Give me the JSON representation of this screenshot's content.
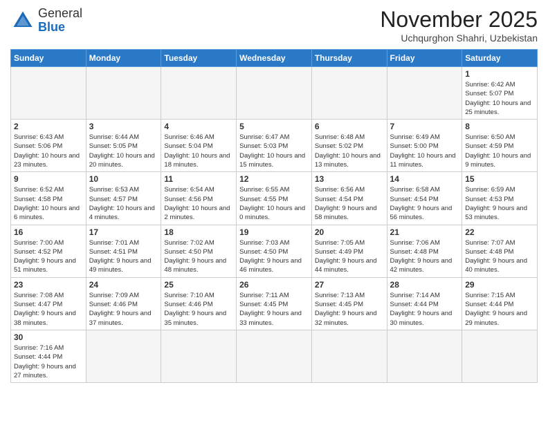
{
  "header": {
    "logo_general": "General",
    "logo_blue": "Blue",
    "month_title": "November 2025",
    "subtitle": "Uchqurghon Shahri, Uzbekistan"
  },
  "weekdays": [
    "Sunday",
    "Monday",
    "Tuesday",
    "Wednesday",
    "Thursday",
    "Friday",
    "Saturday"
  ],
  "weeks": [
    [
      {
        "day": "",
        "info": ""
      },
      {
        "day": "",
        "info": ""
      },
      {
        "day": "",
        "info": ""
      },
      {
        "day": "",
        "info": ""
      },
      {
        "day": "",
        "info": ""
      },
      {
        "day": "",
        "info": ""
      },
      {
        "day": "1",
        "info": "Sunrise: 6:42 AM\nSunset: 5:07 PM\nDaylight: 10 hours and 25 minutes."
      }
    ],
    [
      {
        "day": "2",
        "info": "Sunrise: 6:43 AM\nSunset: 5:06 PM\nDaylight: 10 hours and 23 minutes."
      },
      {
        "day": "3",
        "info": "Sunrise: 6:44 AM\nSunset: 5:05 PM\nDaylight: 10 hours and 20 minutes."
      },
      {
        "day": "4",
        "info": "Sunrise: 6:46 AM\nSunset: 5:04 PM\nDaylight: 10 hours and 18 minutes."
      },
      {
        "day": "5",
        "info": "Sunrise: 6:47 AM\nSunset: 5:03 PM\nDaylight: 10 hours and 15 minutes."
      },
      {
        "day": "6",
        "info": "Sunrise: 6:48 AM\nSunset: 5:02 PM\nDaylight: 10 hours and 13 minutes."
      },
      {
        "day": "7",
        "info": "Sunrise: 6:49 AM\nSunset: 5:00 PM\nDaylight: 10 hours and 11 minutes."
      },
      {
        "day": "8",
        "info": "Sunrise: 6:50 AM\nSunset: 4:59 PM\nDaylight: 10 hours and 9 minutes."
      }
    ],
    [
      {
        "day": "9",
        "info": "Sunrise: 6:52 AM\nSunset: 4:58 PM\nDaylight: 10 hours and 6 minutes."
      },
      {
        "day": "10",
        "info": "Sunrise: 6:53 AM\nSunset: 4:57 PM\nDaylight: 10 hours and 4 minutes."
      },
      {
        "day": "11",
        "info": "Sunrise: 6:54 AM\nSunset: 4:56 PM\nDaylight: 10 hours and 2 minutes."
      },
      {
        "day": "12",
        "info": "Sunrise: 6:55 AM\nSunset: 4:55 PM\nDaylight: 10 hours and 0 minutes."
      },
      {
        "day": "13",
        "info": "Sunrise: 6:56 AM\nSunset: 4:54 PM\nDaylight: 9 hours and 58 minutes."
      },
      {
        "day": "14",
        "info": "Sunrise: 6:58 AM\nSunset: 4:54 PM\nDaylight: 9 hours and 56 minutes."
      },
      {
        "day": "15",
        "info": "Sunrise: 6:59 AM\nSunset: 4:53 PM\nDaylight: 9 hours and 53 minutes."
      }
    ],
    [
      {
        "day": "16",
        "info": "Sunrise: 7:00 AM\nSunset: 4:52 PM\nDaylight: 9 hours and 51 minutes."
      },
      {
        "day": "17",
        "info": "Sunrise: 7:01 AM\nSunset: 4:51 PM\nDaylight: 9 hours and 49 minutes."
      },
      {
        "day": "18",
        "info": "Sunrise: 7:02 AM\nSunset: 4:50 PM\nDaylight: 9 hours and 48 minutes."
      },
      {
        "day": "19",
        "info": "Sunrise: 7:03 AM\nSunset: 4:50 PM\nDaylight: 9 hours and 46 minutes."
      },
      {
        "day": "20",
        "info": "Sunrise: 7:05 AM\nSunset: 4:49 PM\nDaylight: 9 hours and 44 minutes."
      },
      {
        "day": "21",
        "info": "Sunrise: 7:06 AM\nSunset: 4:48 PM\nDaylight: 9 hours and 42 minutes."
      },
      {
        "day": "22",
        "info": "Sunrise: 7:07 AM\nSunset: 4:48 PM\nDaylight: 9 hours and 40 minutes."
      }
    ],
    [
      {
        "day": "23",
        "info": "Sunrise: 7:08 AM\nSunset: 4:47 PM\nDaylight: 9 hours and 38 minutes."
      },
      {
        "day": "24",
        "info": "Sunrise: 7:09 AM\nSunset: 4:46 PM\nDaylight: 9 hours and 37 minutes."
      },
      {
        "day": "25",
        "info": "Sunrise: 7:10 AM\nSunset: 4:46 PM\nDaylight: 9 hours and 35 minutes."
      },
      {
        "day": "26",
        "info": "Sunrise: 7:11 AM\nSunset: 4:45 PM\nDaylight: 9 hours and 33 minutes."
      },
      {
        "day": "27",
        "info": "Sunrise: 7:13 AM\nSunset: 4:45 PM\nDaylight: 9 hours and 32 minutes."
      },
      {
        "day": "28",
        "info": "Sunrise: 7:14 AM\nSunset: 4:44 PM\nDaylight: 9 hours and 30 minutes."
      },
      {
        "day": "29",
        "info": "Sunrise: 7:15 AM\nSunset: 4:44 PM\nDaylight: 9 hours and 29 minutes."
      }
    ],
    [
      {
        "day": "30",
        "info": "Sunrise: 7:16 AM\nSunset: 4:44 PM\nDaylight: 9 hours and 27 minutes."
      },
      {
        "day": "",
        "info": ""
      },
      {
        "day": "",
        "info": ""
      },
      {
        "day": "",
        "info": ""
      },
      {
        "day": "",
        "info": ""
      },
      {
        "day": "",
        "info": ""
      },
      {
        "day": "",
        "info": ""
      }
    ]
  ]
}
